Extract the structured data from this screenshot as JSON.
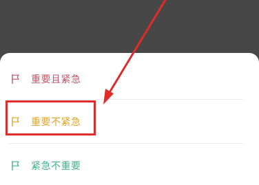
{
  "sheet": {
    "options": [
      {
        "label": "重要且紧急",
        "color": "#c0556a",
        "icon": "flag-icon"
      },
      {
        "label": "重要不紧急",
        "color": "#e1a526",
        "icon": "flag-icon"
      },
      {
        "label": "紧急不重要",
        "color": "#3fb38b",
        "icon": "flag-icon"
      }
    ]
  },
  "annotation": {
    "highlight_color": "#e12b2b",
    "arrow_color": "#e12b2b"
  }
}
